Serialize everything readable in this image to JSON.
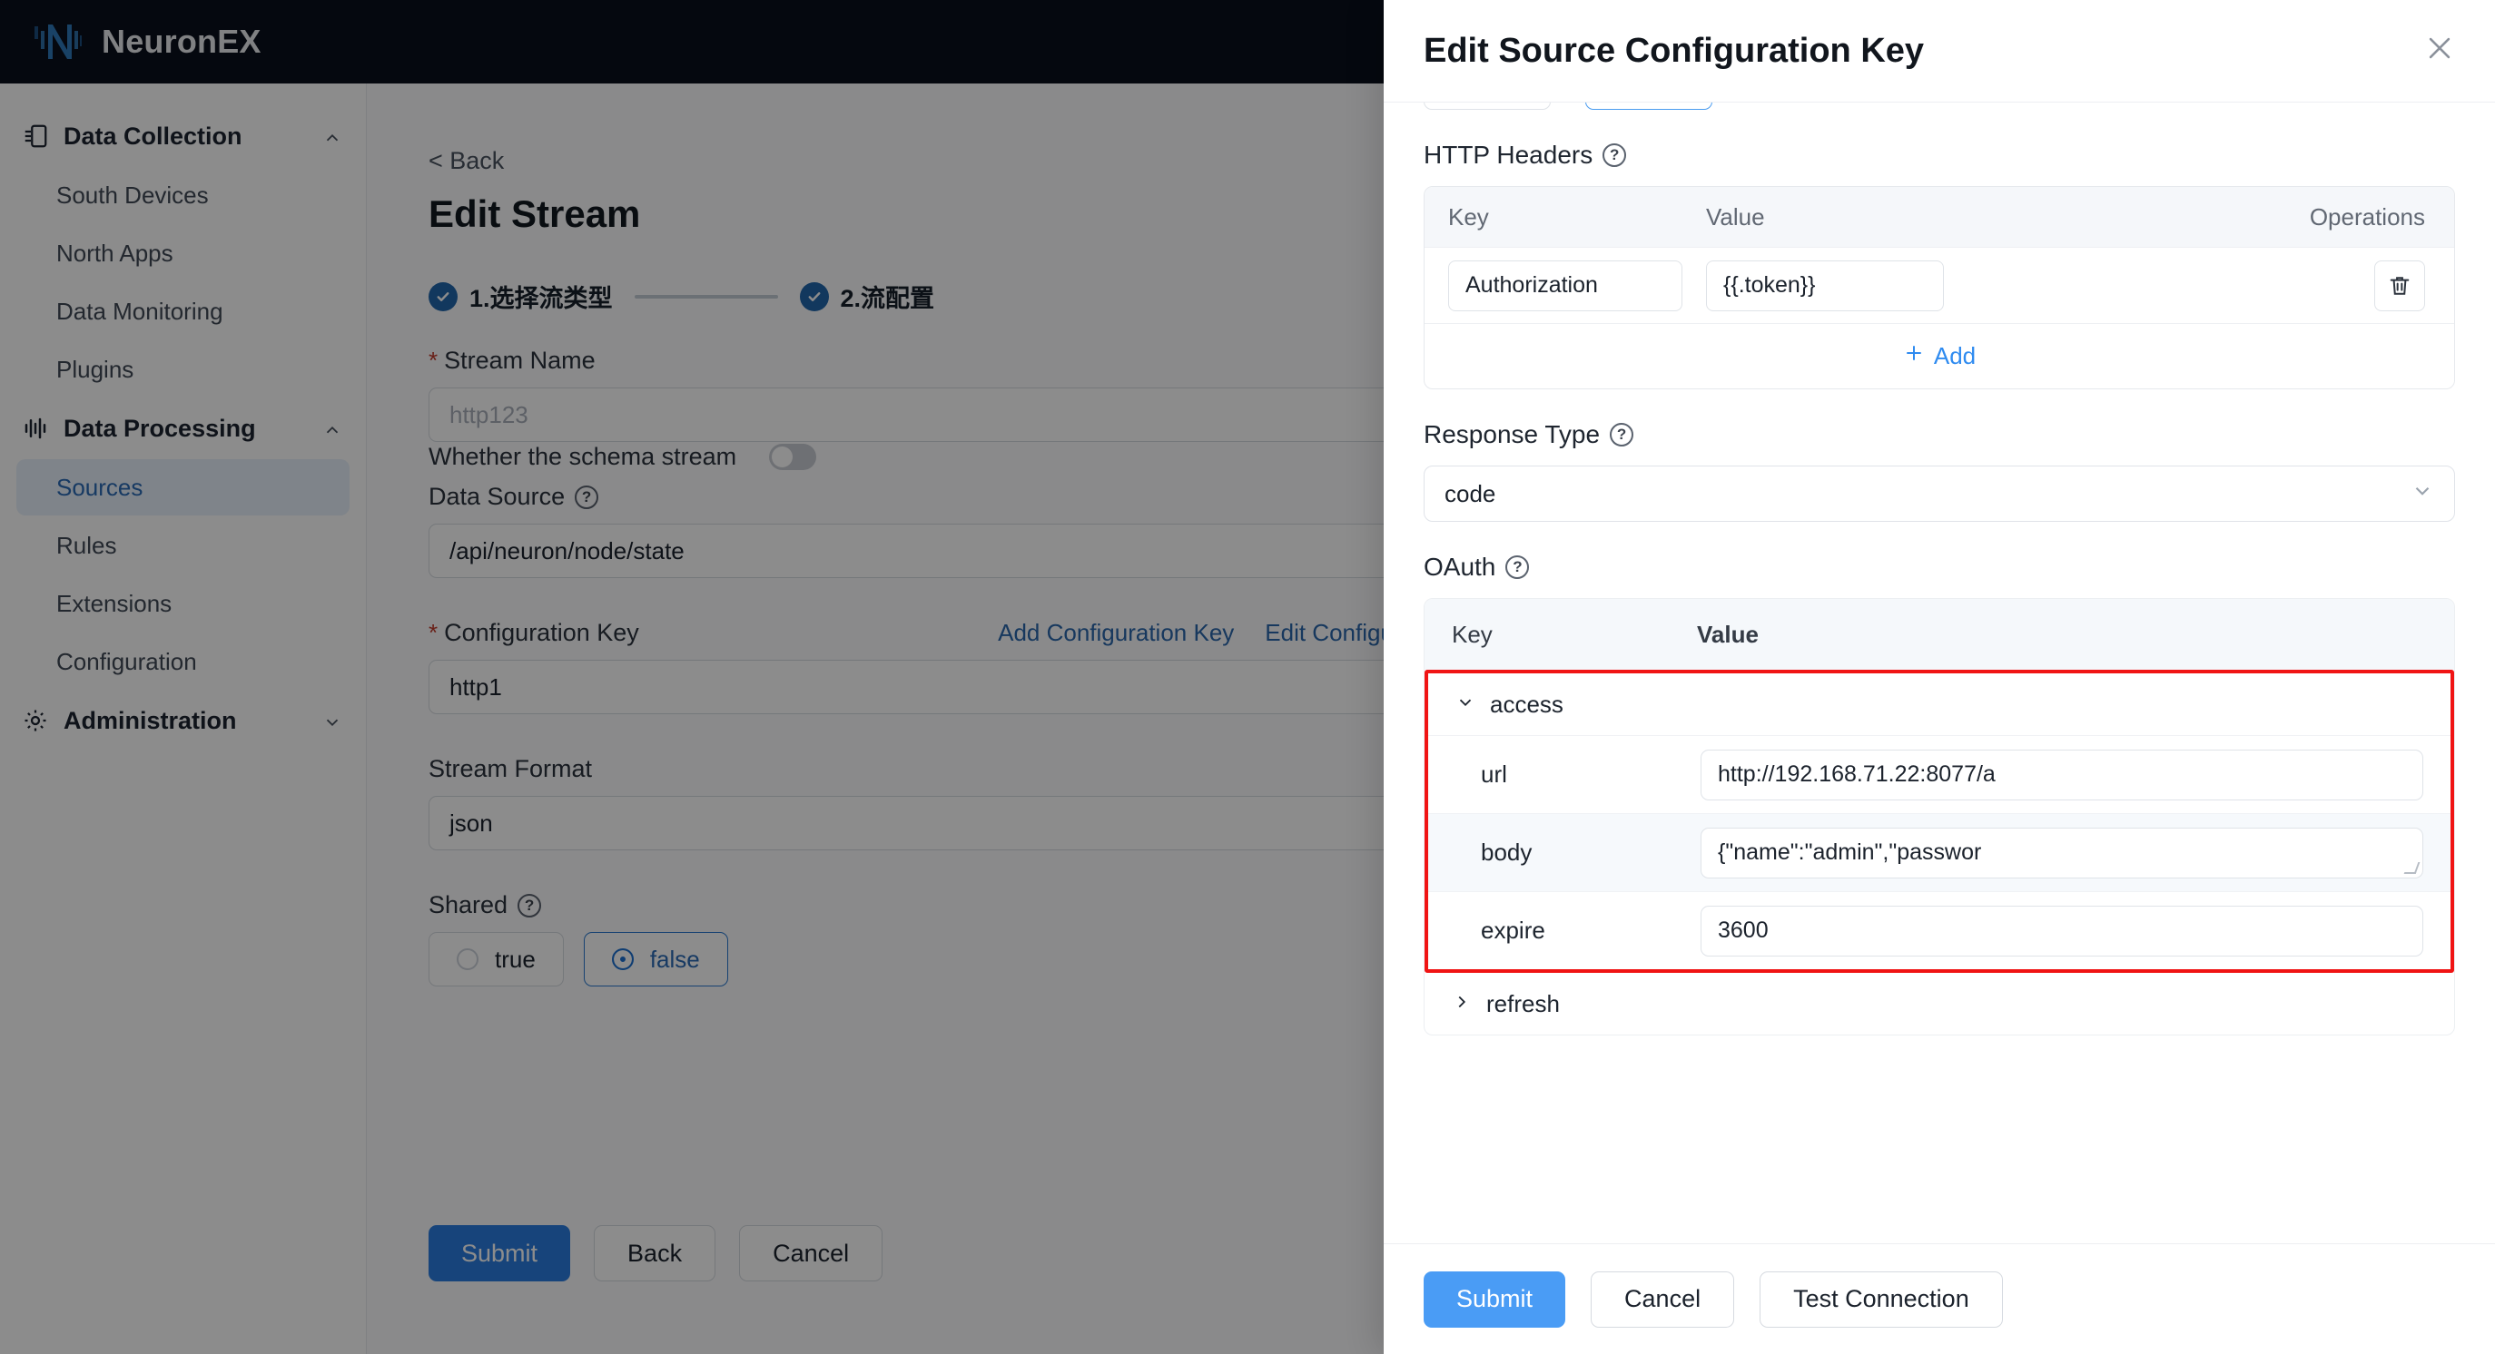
{
  "app": {
    "brand": "NeuronEX",
    "logo_icon": "neuron-logo-icon"
  },
  "sidebar": {
    "groups": [
      {
        "label": "Data Collection",
        "icon": "data-collection-icon",
        "chevron": "chevron-up-icon",
        "items": [
          {
            "label": "South Devices",
            "active": false
          },
          {
            "label": "North Apps",
            "active": false
          },
          {
            "label": "Data Monitoring",
            "active": false
          },
          {
            "label": "Plugins",
            "active": false
          }
        ]
      },
      {
        "label": "Data Processing",
        "icon": "data-processing-icon",
        "chevron": "chevron-up-icon",
        "items": [
          {
            "label": "Sources",
            "active": true
          },
          {
            "label": "Rules",
            "active": false
          },
          {
            "label": "Extensions",
            "active": false
          },
          {
            "label": "Configuration",
            "active": false
          }
        ]
      },
      {
        "label": "Administration",
        "icon": "gear-icon",
        "chevron": "chevron-down-icon",
        "items": []
      }
    ]
  },
  "main": {
    "back_label": "< Back",
    "title": "Edit Stream",
    "steps": [
      {
        "label": "1.选择流类型",
        "done": true
      },
      {
        "label": "2.流配置",
        "done": true
      }
    ],
    "fields": {
      "stream_name": {
        "label": "Stream Name",
        "required": true,
        "placeholder": "http123",
        "value": ""
      },
      "schema_stream": {
        "label": "Whether the schema stream",
        "value": "off"
      },
      "data_source": {
        "label": "Data Source",
        "has_help": true,
        "value": "/api/neuron/node/state"
      },
      "configuration_key": {
        "label": "Configuration Key",
        "required": true,
        "value": "http1",
        "links": [
          "Add Configuration Key",
          "Edit Configuration Key"
        ]
      },
      "stream_format": {
        "label": "Stream Format",
        "value": "json"
      },
      "shared": {
        "label": "Shared",
        "has_help": true,
        "options": [
          {
            "label": "true",
            "selected": false
          },
          {
            "label": "false",
            "selected": true
          }
        ]
      }
    },
    "buttons": [
      {
        "label": "Submit",
        "style": "primary"
      },
      {
        "label": "Back",
        "style": "ghost"
      },
      {
        "label": "Cancel",
        "style": "ghost"
      }
    ]
  },
  "drawer": {
    "title": "Edit Source Configuration Key",
    "close_icon": "close-icon",
    "http_headers": {
      "label": "HTTP Headers",
      "has_help": true,
      "columns": [
        "Key",
        "Value",
        "Operations"
      ],
      "rows": [
        {
          "key": "Authorization",
          "value": "{{.token}}",
          "delete_icon": "trash-icon"
        }
      ],
      "add_label": "Add",
      "add_icon": "plus-icon"
    },
    "response_type": {
      "label": "Response Type",
      "has_help": true,
      "value": "code",
      "chevron": "chevron-down-icon"
    },
    "oauth": {
      "label": "OAuth",
      "has_help": true,
      "columns": [
        "Key",
        "Value"
      ],
      "groups": [
        {
          "name": "access",
          "expanded": true,
          "chevron": "chevron-down-icon",
          "highlighted": true,
          "rows": [
            {
              "key": "url",
              "value": "http://192.168.71.22:8077/a",
              "type": "input"
            },
            {
              "key": "body",
              "value": "{\"name\":\"admin\",\"passwor",
              "type": "textarea"
            },
            {
              "key": "expire",
              "value": "3600",
              "type": "input"
            }
          ]
        },
        {
          "name": "refresh",
          "expanded": false,
          "chevron": "chevron-right-icon",
          "highlighted": false,
          "rows": []
        }
      ]
    },
    "buttons": [
      {
        "label": "Submit",
        "style": "primary"
      },
      {
        "label": "Cancel",
        "style": "ghost"
      },
      {
        "label": "Test Connection",
        "style": "ghost"
      }
    ]
  },
  "colors": {
    "brand_dark": "#0a0f1c",
    "accent": "#2a7de1",
    "link": "#2a67ab",
    "highlight": "#f01414",
    "required": "#c0392b"
  }
}
